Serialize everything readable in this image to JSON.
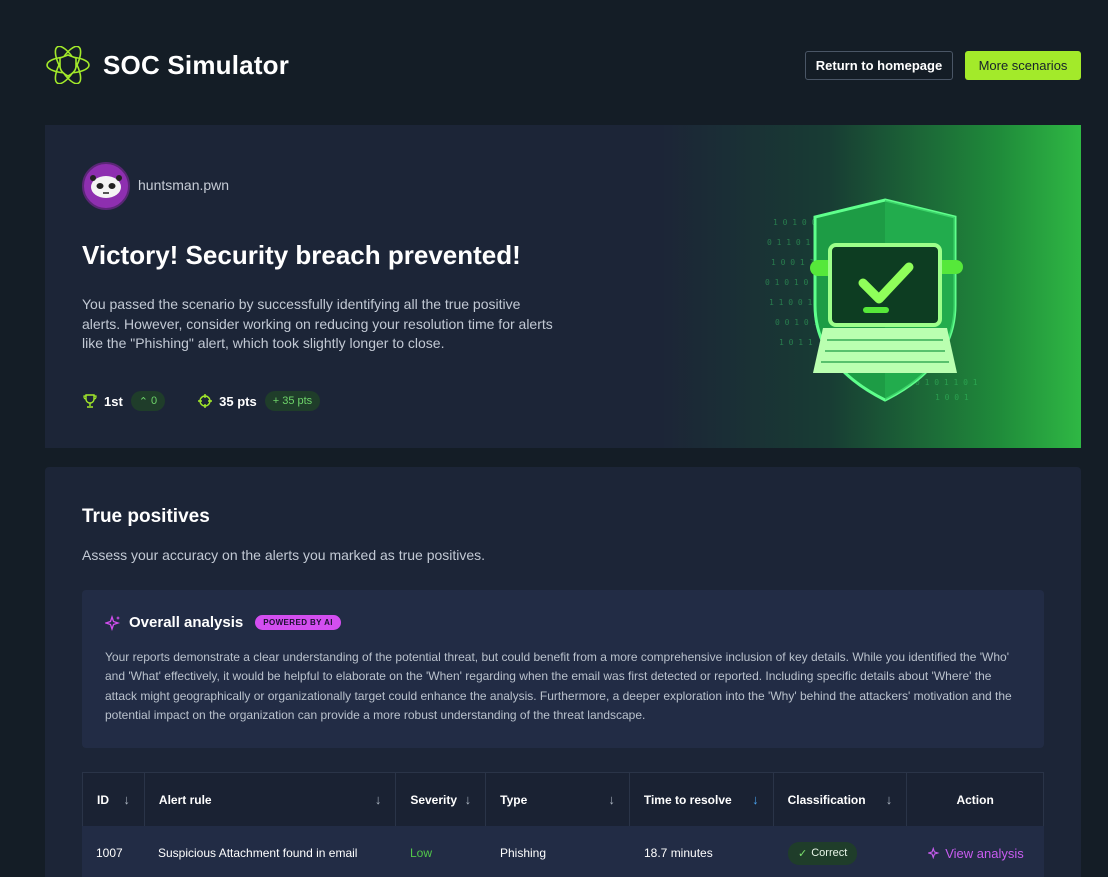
{
  "app": {
    "title": "SOC Simulator",
    "logo_icon": "atom-shield-icon"
  },
  "header": {
    "return_label": "Return to homepage",
    "more_label": "More scenarios"
  },
  "hero": {
    "username": "huntsman.pwn",
    "title": "Victory! Security breach prevented!",
    "description": "You passed the scenario by successfully identifying all the true positive alerts. However, consider working on reducing your resolution time for alerts like the \"Phishing\" alert, which took slightly longer to close.",
    "rank": "1st",
    "rank_change": "0",
    "points": "35 pts",
    "points_change": "+ 35 pts"
  },
  "true_positives": {
    "title": "True positives",
    "subtitle": "Assess your accuracy on the alerts you marked as true positives.",
    "analysis": {
      "title": "Overall analysis",
      "badge": "POWERED BY AI",
      "text": "Your reports demonstrate a clear understanding of the potential threat, but could benefit from a more comprehensive inclusion of key details. While you identified the 'Who' and 'What' effectively, it would be helpful to elaborate on the 'When' regarding when the email was first detected or reported. Including specific details about 'Where' the attack might geographically or organizationally target could enhance the analysis. Furthermore, a deeper exploration into the 'Why' behind the attackers' motivation and the potential impact on the organization can provide a more robust understanding of the threat landscape."
    },
    "columns": [
      "ID",
      "Alert rule",
      "Severity",
      "Type",
      "Time to resolve",
      "Classification",
      "Action"
    ],
    "rows": [
      {
        "id": "1007",
        "rule": "Suspicious Attachment found in email",
        "severity": "Low",
        "type": "Phishing",
        "time": "18.7 minutes",
        "classification": "Correct",
        "action": "View analysis"
      }
    ]
  },
  "colors": {
    "accent": "#a3ea2a",
    "background": "#141d26",
    "card": "#1c2537",
    "ai_purple": "#d34ef0",
    "success": "#52c84a"
  }
}
